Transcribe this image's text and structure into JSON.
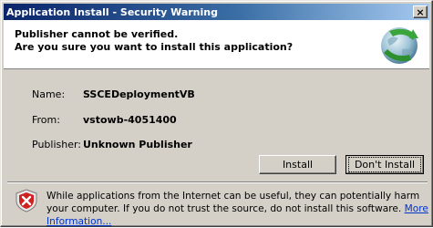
{
  "window": {
    "title": "Application Install - Security Warning",
    "close_glyph": "×"
  },
  "header": {
    "line1": "Publisher cannot be verified.",
    "line2": "Are you sure you want to install this application?",
    "logo_icon": "clickonce-globe-icon"
  },
  "details": {
    "name_label": "Name:",
    "name_value": "SSCEDeploymentVB",
    "from_label": "From:",
    "from_value": "vstowb-4051400",
    "publisher_label": "Publisher:",
    "publisher_value": "Unknown Publisher"
  },
  "buttons": {
    "install_label": "Install",
    "dont_install_label": "Don't Install"
  },
  "warning": {
    "icon": "shield-warning-icon",
    "text": "While applications from the Internet can be useful, they can potentially harm your computer. If you do not trust the source, do not install this software.",
    "link_text": "More Information..."
  },
  "colors": {
    "titlebar_start": "#0a246a",
    "titlebar_end": "#a6caf0",
    "dialog_bg": "#d4d0c8",
    "link": "#0033cc",
    "shield_red": "#cc2222"
  }
}
